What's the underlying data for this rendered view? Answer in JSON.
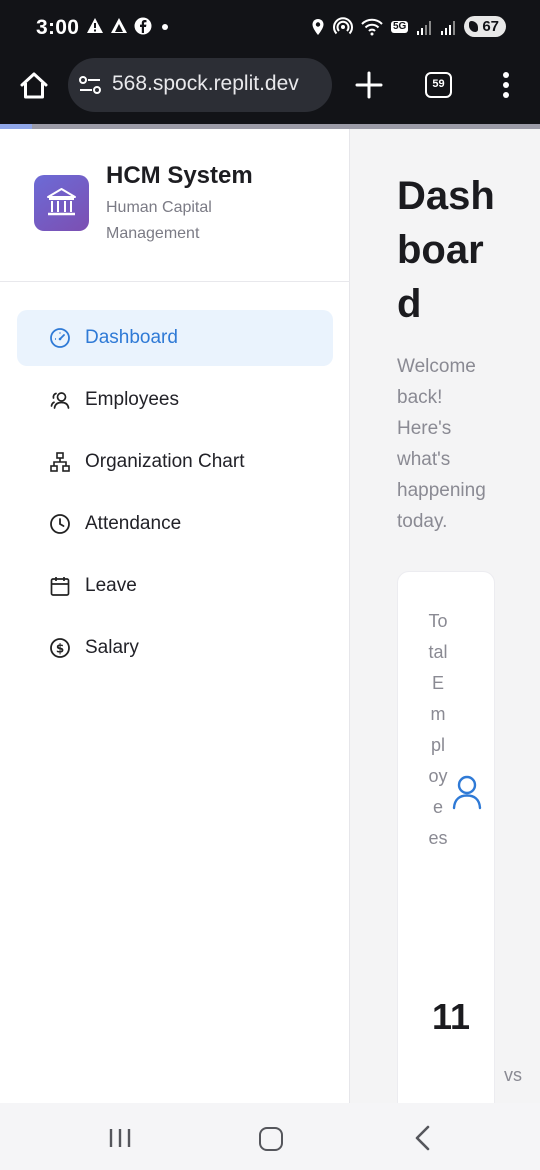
{
  "status_bar": {
    "time": "3:00",
    "battery": "67",
    "network": "5G"
  },
  "browser": {
    "url": "568.spock.replit.dev",
    "tab_count": "59"
  },
  "page_load_progress": 0.06,
  "sidebar": {
    "brand_title": "HCM System",
    "brand_subtitle": "Human Capital Management",
    "items": [
      {
        "label": "Dashboard",
        "icon": "gauge-icon",
        "active": true
      },
      {
        "label": "Employees",
        "icon": "users-icon",
        "active": false
      },
      {
        "label": "Organization Chart",
        "icon": "org-chart-icon",
        "active": false
      },
      {
        "label": "Attendance",
        "icon": "clock-icon",
        "active": false
      },
      {
        "label": "Leave",
        "icon": "calendar-icon",
        "active": false
      },
      {
        "label": "Salary",
        "icon": "dollar-circle-icon",
        "active": false
      }
    ]
  },
  "main": {
    "title": "Dashboard",
    "subtitle": "Welcome back! Here's what's happening today.",
    "card": {
      "label": "Total Employees",
      "value": "11",
      "icon": "user-icon",
      "suffix": "vs"
    }
  },
  "colors": {
    "accent": "#2f7ad6",
    "active_bg": "#eaf3fd",
    "logo_start": "#6c6bd6",
    "logo_end": "#7c4fb2"
  }
}
